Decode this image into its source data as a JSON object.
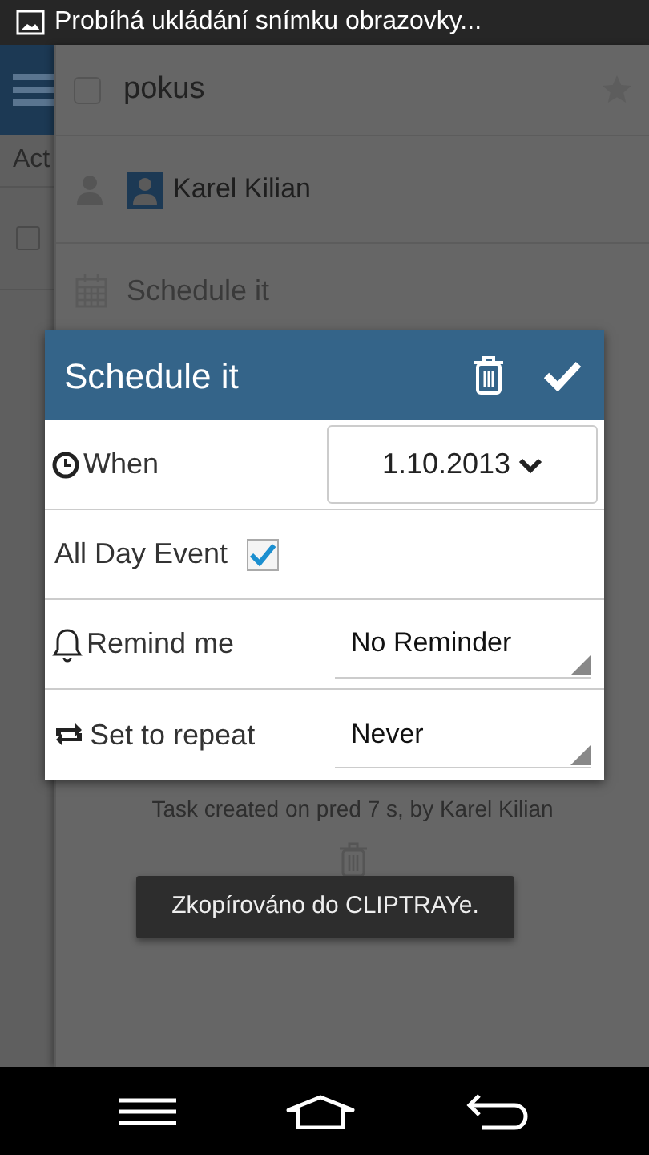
{
  "status_bar": {
    "notification": "Probíhá ukládání snímku obrazovky..."
  },
  "sidebar": {
    "tab": "Act",
    "item_checked": false
  },
  "task": {
    "title": "pokus",
    "done": false,
    "starred": false,
    "assignee": "Karel Kilian",
    "schedule_placeholder": "Schedule it",
    "footer": "Task created on pred 7 s, by Karel Kilian"
  },
  "dialog": {
    "title": "Schedule it",
    "rows": [
      {
        "kind": "date",
        "label": "When",
        "value": "1.10.2013"
      },
      {
        "kind": "checkbox",
        "label": "All Day Event",
        "checked": true
      },
      {
        "kind": "select",
        "label": "Remind me",
        "value": "No Reminder"
      },
      {
        "kind": "select",
        "label": "Set to repeat",
        "value": "Never"
      }
    ]
  },
  "toast": "Zkopírováno do CLIPTRAYe."
}
